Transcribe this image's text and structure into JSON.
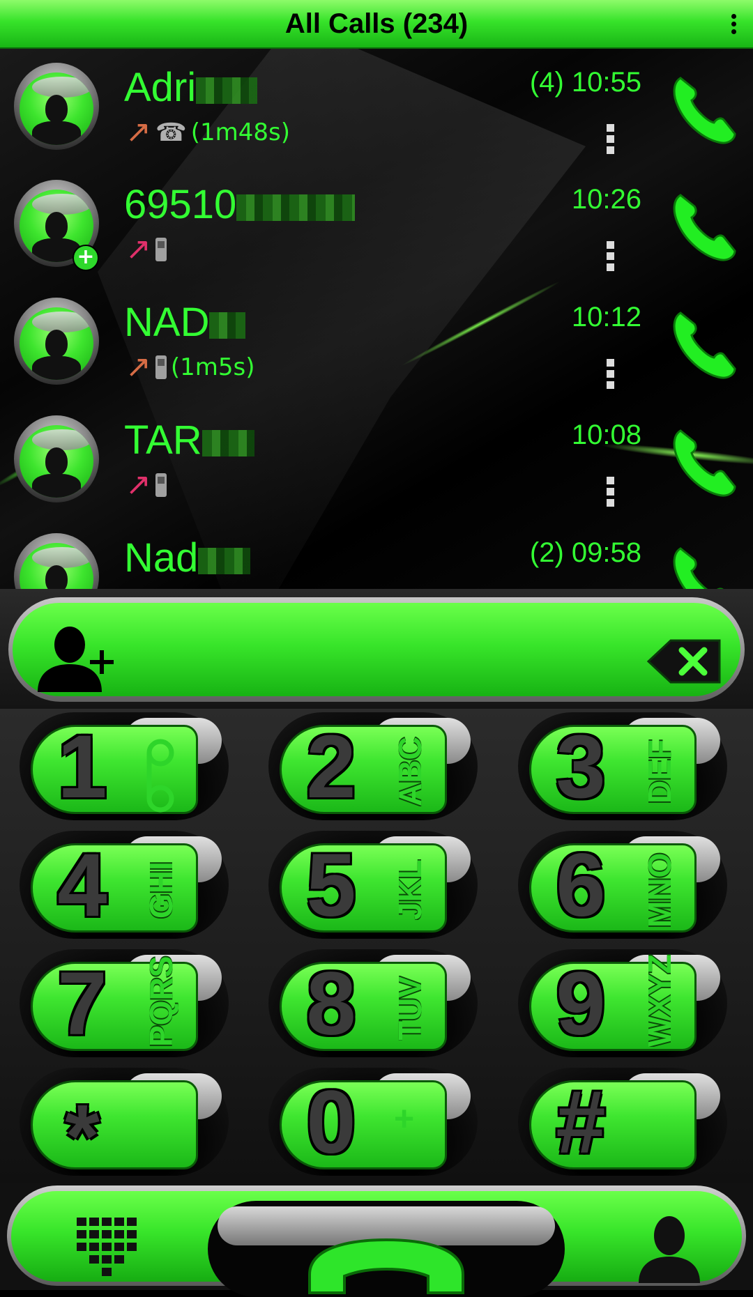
{
  "header": {
    "title": "All Calls (234)",
    "menu_icon": "overflow-menu-icon"
  },
  "calls": [
    {
      "name": "Adri",
      "time": "(4) 10:55",
      "direction": "outgoing",
      "device": "landline",
      "duration": "(1m48s)"
    },
    {
      "name": "69510",
      "time": "10:26",
      "direction": "missed",
      "device": "mobile",
      "duration": "",
      "badge": "+"
    },
    {
      "name": "NAD",
      "time": "10:12",
      "direction": "outgoing",
      "device": "mobile",
      "duration": "(1m5s)"
    },
    {
      "name": "TAR",
      "time": "10:08",
      "direction": "missed",
      "device": "mobile",
      "duration": ""
    },
    {
      "name": "Nad",
      "time": "(2) 09:58",
      "direction": "",
      "device": "",
      "duration": ""
    }
  ],
  "dial_input": {
    "value": "",
    "placeholder": ""
  },
  "keypad": [
    {
      "digit": "1",
      "letters": ""
    },
    {
      "digit": "2",
      "letters": "ABC"
    },
    {
      "digit": "3",
      "letters": "DEF"
    },
    {
      "digit": "4",
      "letters": "GHI"
    },
    {
      "digit": "5",
      "letters": "JKL"
    },
    {
      "digit": "6",
      "letters": "MNO"
    },
    {
      "digit": "7",
      "letters": "PQRS"
    },
    {
      "digit": "8",
      "letters": "TUV"
    },
    {
      "digit": "9",
      "letters": "WXYZ"
    },
    {
      "digit": "*",
      "letters": ""
    },
    {
      "digit": "0",
      "letters": "+"
    },
    {
      "digit": "#",
      "letters": ""
    }
  ],
  "colors": {
    "accent": "#33ff33",
    "header": "#37e32a",
    "missed": "#e0306a",
    "outgoing": "#d66c45"
  },
  "icons": [
    "add-contact-icon",
    "backspace-icon",
    "dialpad-icon",
    "call-icon",
    "contacts-icon",
    "voicemail-icon"
  ]
}
